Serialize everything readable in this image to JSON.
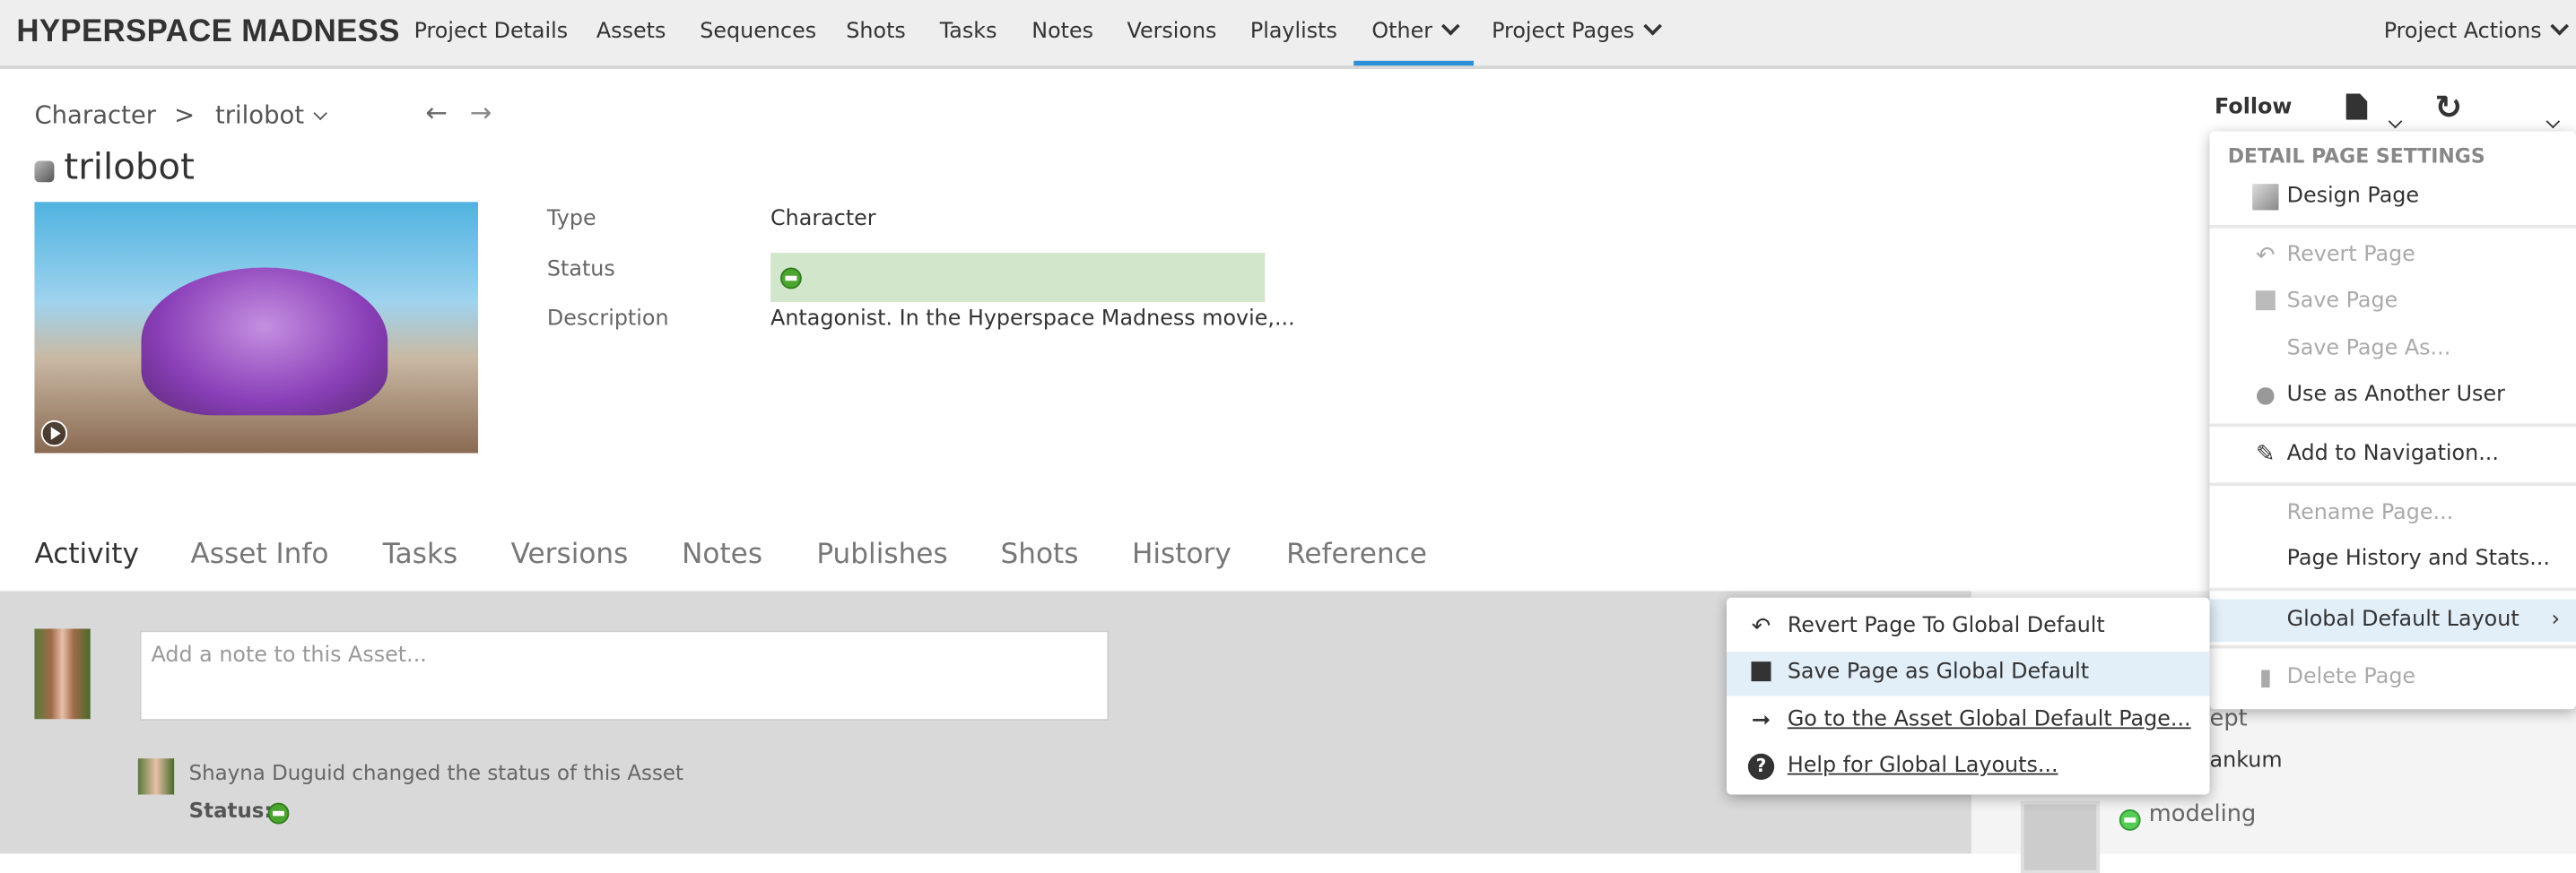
{
  "app": {
    "title": "HYPERSPACE MADNESS"
  },
  "nav": {
    "items": [
      "Project Details",
      "Assets",
      "Sequences",
      "Shots",
      "Tasks",
      "Notes",
      "Versions",
      "Playlists",
      "Other",
      "Project Pages"
    ],
    "active": "Other",
    "project_actions": "Project Actions",
    "accent": "#2d8fd5"
  },
  "breadcrumb": {
    "parent": "Character",
    "separator": ">",
    "current": "trilobot"
  },
  "entity": {
    "title": "trilobot",
    "fields": [
      {
        "label": "Type",
        "value": "Character"
      },
      {
        "label": "Status",
        "value": ""
      },
      {
        "label": "Description",
        "value": "Antagonist. In the Hyperspace Madness movie,..."
      }
    ],
    "status_color": "#4ca531",
    "status_bg": "#d2e6cc"
  },
  "header_actions": {
    "follow": "Follow"
  },
  "tabs": [
    "Activity",
    "Asset Info",
    "Tasks",
    "Versions",
    "Notes",
    "Publishes",
    "Shots",
    "History",
    "Reference"
  ],
  "activity": {
    "note_placeholder": "Add a note to this Asset...",
    "items": [
      {
        "text": "Shayna Duguid changed the status of this Asset",
        "status_label": "Status:"
      }
    ]
  },
  "sidebar": {
    "fragments": [
      "ept",
      "ankum",
      "modeling"
    ]
  },
  "settings_menu": {
    "header": "DETAIL PAGE SETTINGS",
    "items": [
      {
        "label": "Design Page",
        "icon": "design-brush-icon",
        "disabled": false
      },
      {
        "label": "Revert Page",
        "icon": "undo-icon",
        "disabled": true
      },
      {
        "label": "Save Page",
        "icon": "floppy-icon",
        "disabled": true
      },
      {
        "label": "Save Page As...",
        "icon": "",
        "disabled": true
      },
      {
        "label": "Use as Another User",
        "icon": "user-icon",
        "disabled": false
      },
      {
        "label": "Add to Navigation...",
        "icon": "pencil-icon",
        "disabled": false
      },
      {
        "label": "Rename Page...",
        "icon": "",
        "disabled": true
      },
      {
        "label": "Page History and Stats...",
        "icon": "",
        "disabled": false
      },
      {
        "label": "Global Default Layout",
        "icon": "",
        "disabled": false,
        "submenu": true
      },
      {
        "label": "Delete Page",
        "icon": "trash-icon",
        "disabled": true
      }
    ]
  },
  "global_submenu": {
    "items": [
      {
        "label": "Revert Page To Global Default",
        "icon": "undo-icon"
      },
      {
        "label": "Save Page as Global Default",
        "icon": "floppy-icon"
      },
      {
        "label": "Go to the Asset Global Default Page...",
        "icon": "arrow-right-icon"
      },
      {
        "label": "Help for Global Layouts...",
        "icon": "help-icon"
      }
    ]
  }
}
